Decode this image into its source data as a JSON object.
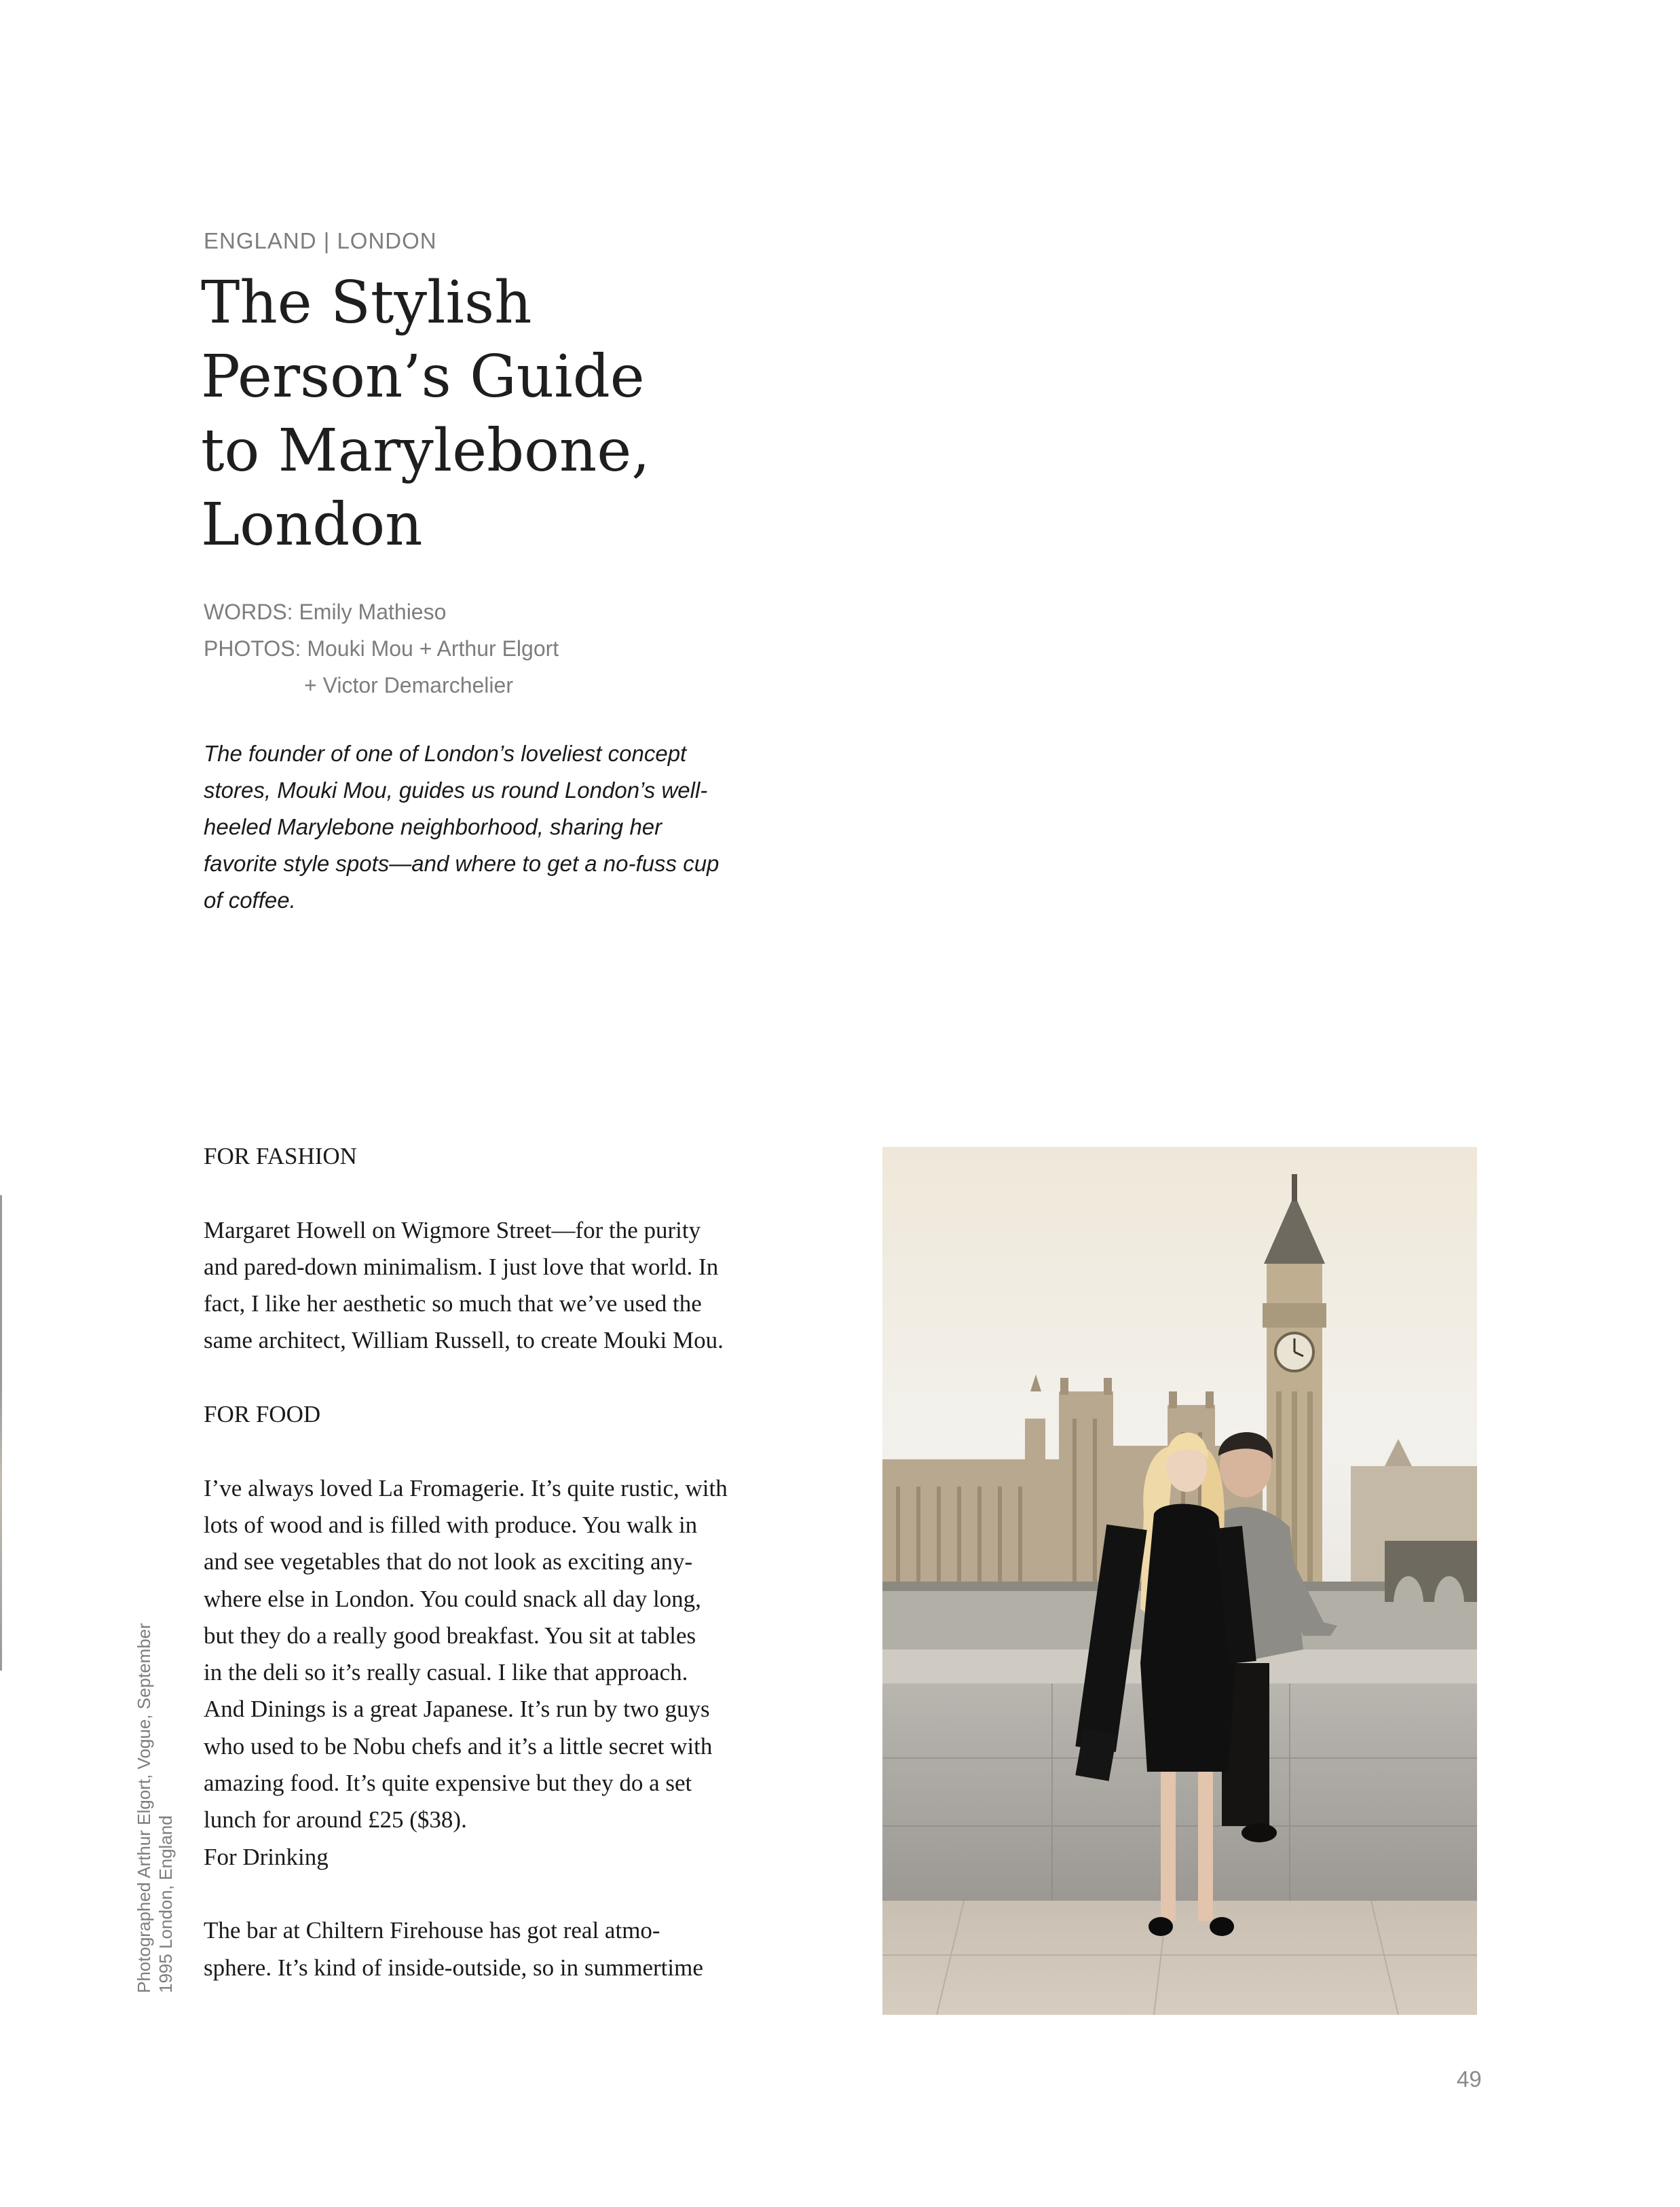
{
  "article": {
    "kicker": "ENGLAND | LONDON",
    "title_lines": [
      "The Stylish",
      "Person’s Guide",
      "to Marylebone,",
      "London"
    ],
    "credits": {
      "words": "WORDS:  Emily Mathieso",
      "photos": "PHOTOS: Mouki Mou + Arthur Elgort",
      "photos_cont": "+ Victor Demarchelier"
    },
    "deck_lines": [
      "The founder of one of London’s loveliest concept",
      "stores, Mouki Mou, guides us round London’s well-",
      "heeled Marylebone neighborhood, sharing her",
      "favorite style spots—and where to get a no-fuss cup",
      "of coffee."
    ]
  },
  "sections": {
    "fashion_heading": "FOR FASHION",
    "fashion_lines": [
      "Margaret Howell on Wigmore Street—for the purity",
      "and pared-down minimalism. I just love that world. In",
      "fact, I like her aesthetic so much that we’ve used the",
      "same architect, William Russell, to create Mouki Mou."
    ],
    "food_heading": "FOR FOOD",
    "food_lines": [
      "I’ve always loved La Fromagerie. It’s quite rustic, with",
      "lots of wood and is filled with produce. You walk in",
      "and see vegetables that do not look as exciting any-",
      "where else in London. You could snack all day long,",
      "but they do a really good breakfast. You sit at tables",
      "in the deli so it’s really casual. I like that approach.",
      "And Dinings is a great Japanese. It’s run by two guys",
      "who used to be Nobu chefs and it’s a little secret with",
      "amazing food. It’s quite expensive but they do a set",
      "lunch for around £25 ($38).",
      "For Drinking"
    ],
    "drink_lines": [
      "The bar at Chiltern Firehouse has got real atmo-",
      "sphere. It’s kind of inside-outside, so in summertime"
    ]
  },
  "photo_caption": {
    "line1": "Photographed Arthur Elgort, Vogue, September",
    "line2": "1995 London, England"
  },
  "page_number": "49"
}
